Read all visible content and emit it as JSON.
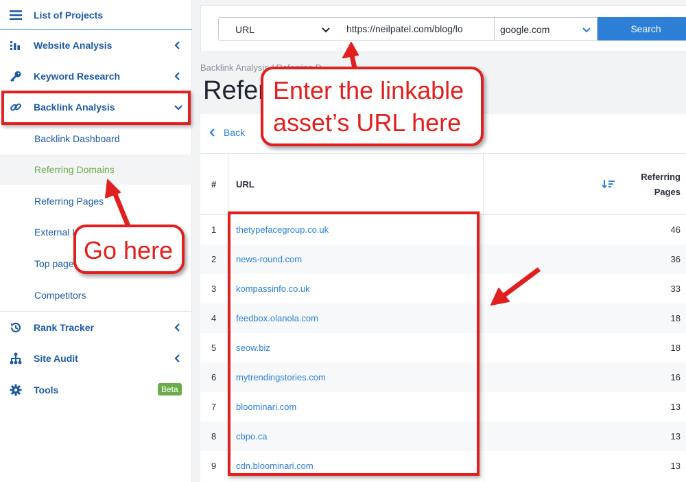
{
  "sidebar": {
    "items": [
      {
        "label": "List of Projects",
        "icon": "list-icon"
      },
      {
        "label": "Website Analysis",
        "icon": "bar-chart-icon"
      },
      {
        "label": "Keyword Research",
        "icon": "key-icon"
      },
      {
        "label": "Backlink Analysis",
        "icon": "link-icon"
      },
      {
        "label": "Rank Tracker",
        "icon": "history-icon"
      },
      {
        "label": "Site Audit",
        "icon": "sitemap-icon"
      },
      {
        "label": "Tools",
        "icon": "gear-icon",
        "badge": "Beta"
      }
    ],
    "backlink_sub": [
      {
        "label": "Backlink Dashboard",
        "active": false
      },
      {
        "label": "Referring Domains",
        "active": true
      },
      {
        "label": "Referring Pages",
        "active": false
      },
      {
        "label": "External L",
        "active": false
      },
      {
        "label": "Top page",
        "active": false
      },
      {
        "label": "Competitors",
        "active": false
      }
    ]
  },
  "search": {
    "type_value": "URL",
    "url_value": "https://neilpatel.com/blog/lo",
    "engine_value": "google.com",
    "button_label": "Search"
  },
  "breadcrumb": "Backlink Analysis / Referring D",
  "page_title": "Refer",
  "card": {
    "back_label": "Back",
    "columns": {
      "num": "#",
      "url": "URL",
      "ref_line1": "Referring",
      "ref_line2": "Pages"
    },
    "rows": [
      {
        "num": "1",
        "url": "thetypefacegroup.co.uk",
        "count": "46"
      },
      {
        "num": "2",
        "url": "news-round.com",
        "count": "36"
      },
      {
        "num": "3",
        "url": "kompassinfo.co.uk",
        "count": "33"
      },
      {
        "num": "4",
        "url": "feedbox.olanola.com",
        "count": "18"
      },
      {
        "num": "5",
        "url": "seow.biz",
        "count": "18"
      },
      {
        "num": "6",
        "url": "mytrendingstories.com",
        "count": "16"
      },
      {
        "num": "7",
        "url": "bloominari.com",
        "count": "13"
      },
      {
        "num": "8",
        "url": "cbpo.ca",
        "count": "13"
      },
      {
        "num": "9",
        "url": "cdn.bloominari.com",
        "count": "13"
      }
    ]
  },
  "annotations": {
    "callout_top_line1": "Enter the linkable",
    "callout_top_line2": "asset’s URL here",
    "callout_left": "Go here",
    "color": "#e21f1f"
  },
  "colors": {
    "link": "#1e5aa0",
    "active": "#6cab4a",
    "accent": "#2c7fd4"
  }
}
